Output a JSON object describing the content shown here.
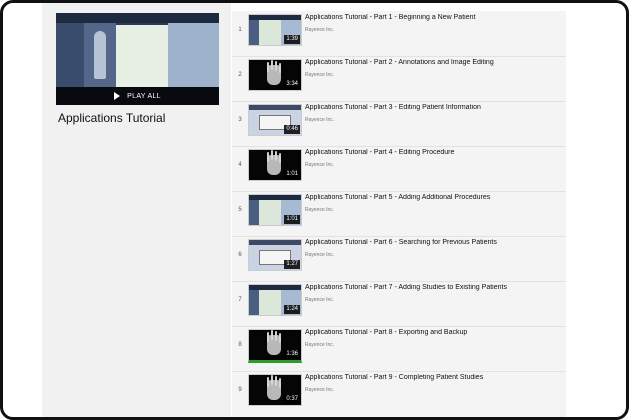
{
  "playlist": {
    "title": "Applications Tutorial",
    "play_all": "PLAY ALL"
  },
  "videos": [
    {
      "index": "1",
      "title": "Applications Tutorial - Part 1 - Beginning a New Patient",
      "channel": "Rayence Inc.",
      "duration": "1:39"
    },
    {
      "index": "2",
      "title": "Applications Tutorial - Part 2 - Annotations and Image Editing",
      "channel": "Rayence Inc.",
      "duration": "3:34"
    },
    {
      "index": "3",
      "title": "Applications Tutorial - Part 3 - Editing Patient Information",
      "channel": "Rayence Inc.",
      "duration": "0:46"
    },
    {
      "index": "4",
      "title": "Applications Tutorial - Part 4 - Editing Procedure",
      "channel": "Rayence Inc.",
      "duration": "1:01"
    },
    {
      "index": "5",
      "title": "Applications Tutorial - Part 5 - Adding Additional Procedures",
      "channel": "Rayence Inc.",
      "duration": "1:01"
    },
    {
      "index": "6",
      "title": "Applications Tutorial - Part 6 - Searching for Previous Patients",
      "channel": "Rayence Inc.",
      "duration": "1:27"
    },
    {
      "index": "7",
      "title": "Applications Tutorial - Part 7 - Adding Studies to Existing Patients",
      "channel": "Rayence Inc.",
      "duration": "1:24"
    },
    {
      "index": "8",
      "title": "Applications Tutorial - Part 8 - Exporting and Backup",
      "channel": "Rayence Inc.",
      "duration": "1:36"
    },
    {
      "index": "9",
      "title": "Applications Tutorial - Part 9 - Completing Patient Studies",
      "channel": "Rayence Inc.",
      "duration": "0:37"
    }
  ]
}
